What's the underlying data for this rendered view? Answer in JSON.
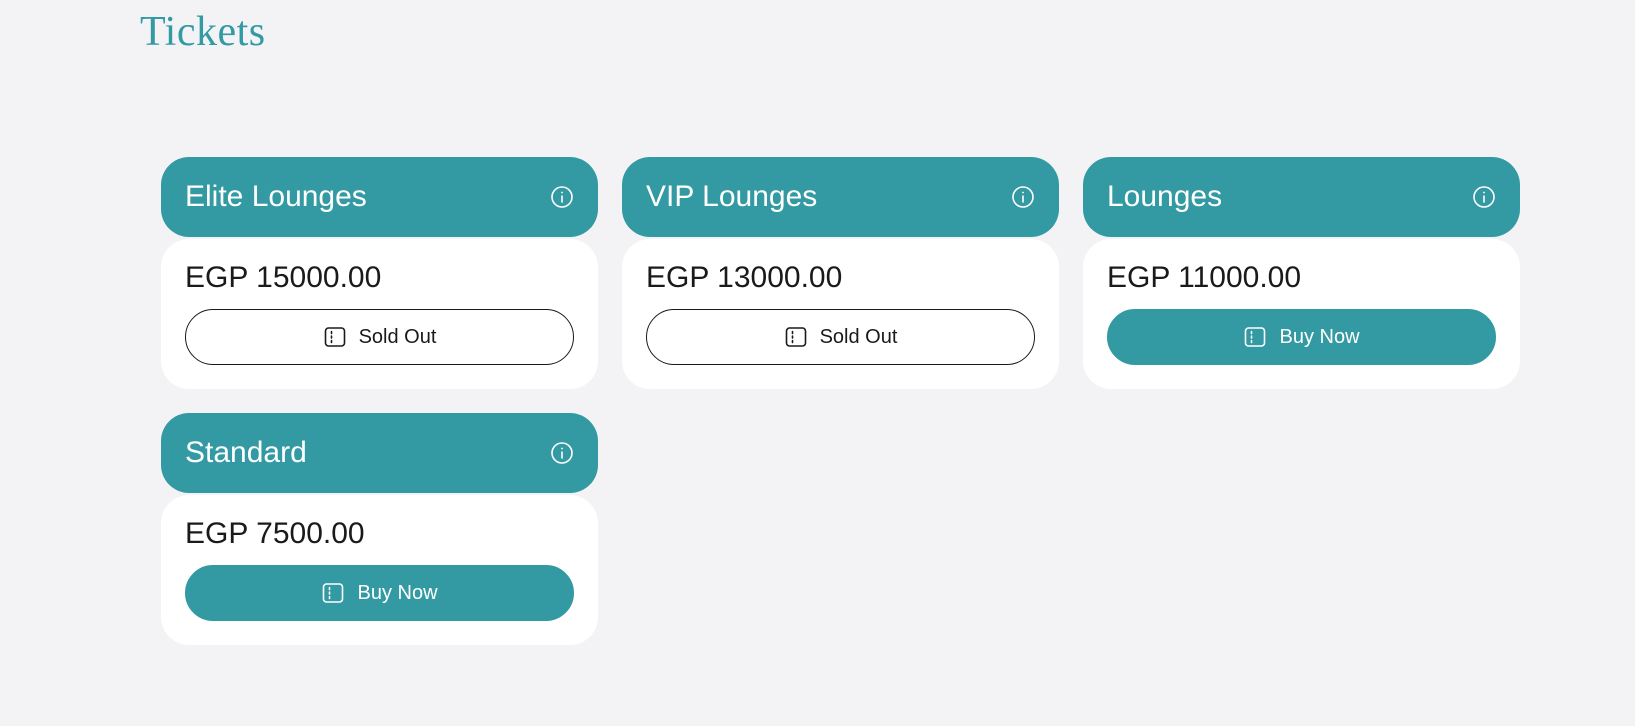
{
  "page": {
    "title": "Tickets"
  },
  "colors": {
    "accent": "#339aa3",
    "background": "#f3f3f6",
    "card": "#ffffff"
  },
  "tickets": [
    {
      "name": "Elite Lounges",
      "price": "EGP 15000.00",
      "button_label": "Sold Out",
      "status": "sold-out",
      "icon": "info-icon",
      "button_icon": "ticket-icon"
    },
    {
      "name": "VIP Lounges",
      "price": "EGP 13000.00",
      "button_label": "Sold Out",
      "status": "sold-out",
      "icon": "info-icon",
      "button_icon": "ticket-icon"
    },
    {
      "name": "Lounges",
      "price": "EGP 11000.00",
      "button_label": "Buy Now",
      "status": "available",
      "icon": "info-icon",
      "button_icon": "ticket-icon"
    },
    {
      "name": "Standard",
      "price": "EGP 7500.00",
      "button_label": "Buy Now",
      "status": "available",
      "icon": "info-icon",
      "button_icon": "ticket-icon"
    }
  ]
}
